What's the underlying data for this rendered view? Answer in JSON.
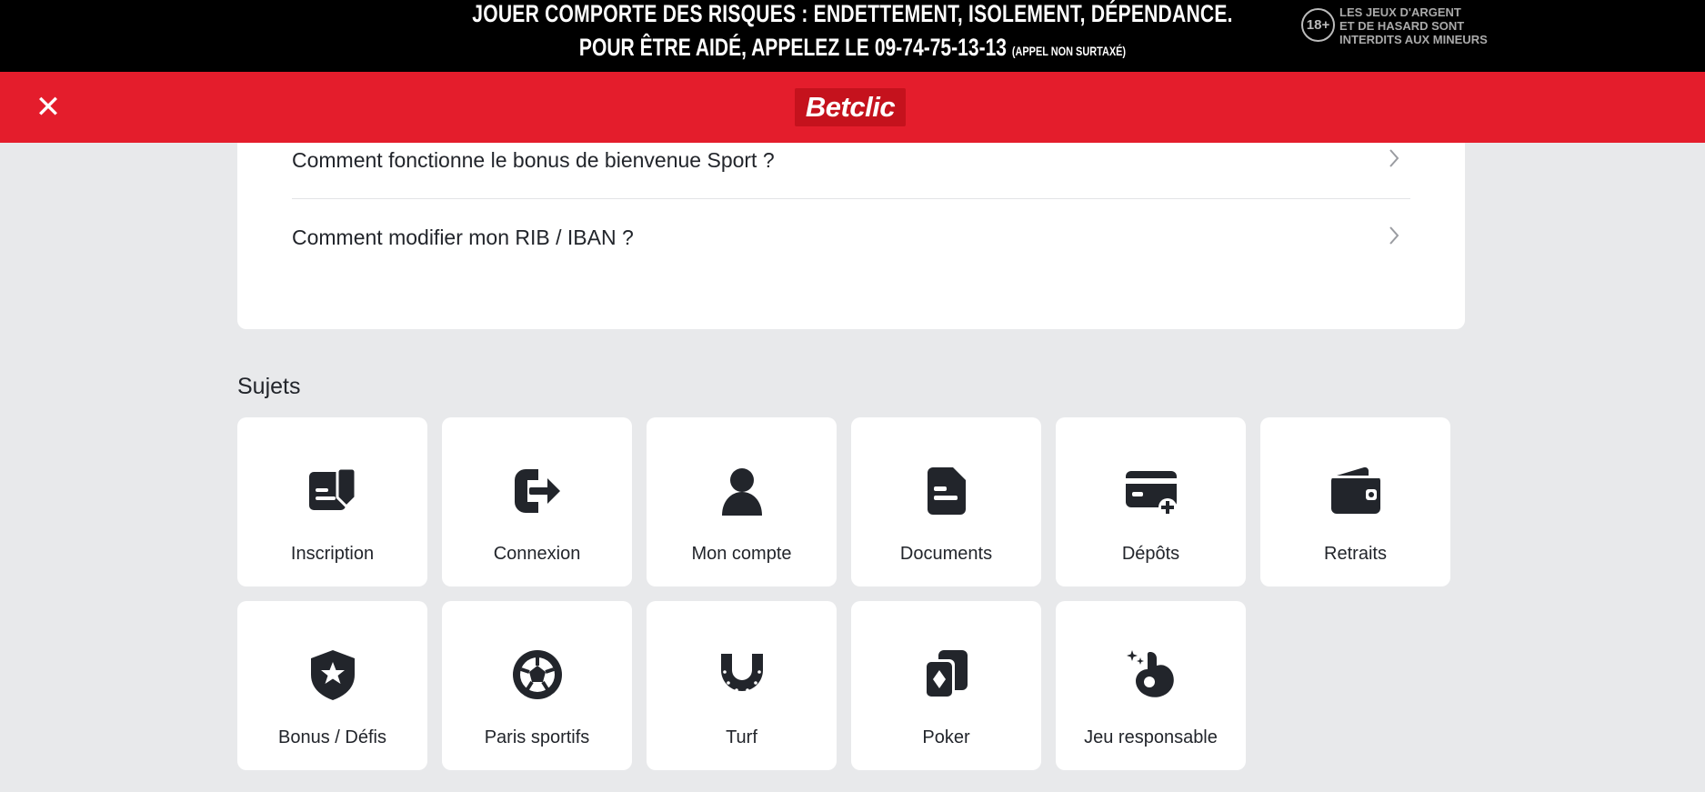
{
  "warning": {
    "line1": "JOUER COMPORTE DES RISQUES : ENDETTEMENT, ISOLEMENT, DÉPENDANCE.",
    "line2": "POUR ÊTRE AIDÉ, APPELEZ LE 09-74-75-13-13",
    "line2_note": "(APPEL NON SURTAXÉ)",
    "age_badge": "18+",
    "age_text": [
      "LES JEUX D'ARGENT",
      "ET DE HASARD SONT",
      "INTERDITS AUX MINEURS"
    ]
  },
  "header": {
    "close_symbol": "✕",
    "logo": "Betclic",
    "brand_color": "#e41d2c"
  },
  "faq": {
    "items": [
      "Comment fonctionne le bonus de bienvenue Sport ?",
      "Comment modifier mon RIB / IBAN ?"
    ]
  },
  "subjects": {
    "title": "Sujets",
    "tiles": [
      {
        "label": "Inscription",
        "icon": "signup-form-icon"
      },
      {
        "label": "Connexion",
        "icon": "login-arrow-icon"
      },
      {
        "label": "Mon compte",
        "icon": "user-icon"
      },
      {
        "label": "Documents",
        "icon": "document-icon"
      },
      {
        "label": "Dépôts",
        "icon": "card-plus-icon"
      },
      {
        "label": "Retraits",
        "icon": "wallet-icon"
      },
      {
        "label": "Bonus / Défis",
        "icon": "shield-star-icon"
      },
      {
        "label": "Paris sportifs",
        "icon": "football-icon"
      },
      {
        "label": "Turf",
        "icon": "horseshoe-icon"
      },
      {
        "label": "Poker",
        "icon": "playing-cards-icon"
      },
      {
        "label": "Jeu responsable",
        "icon": "ok-hand-icon"
      }
    ]
  }
}
